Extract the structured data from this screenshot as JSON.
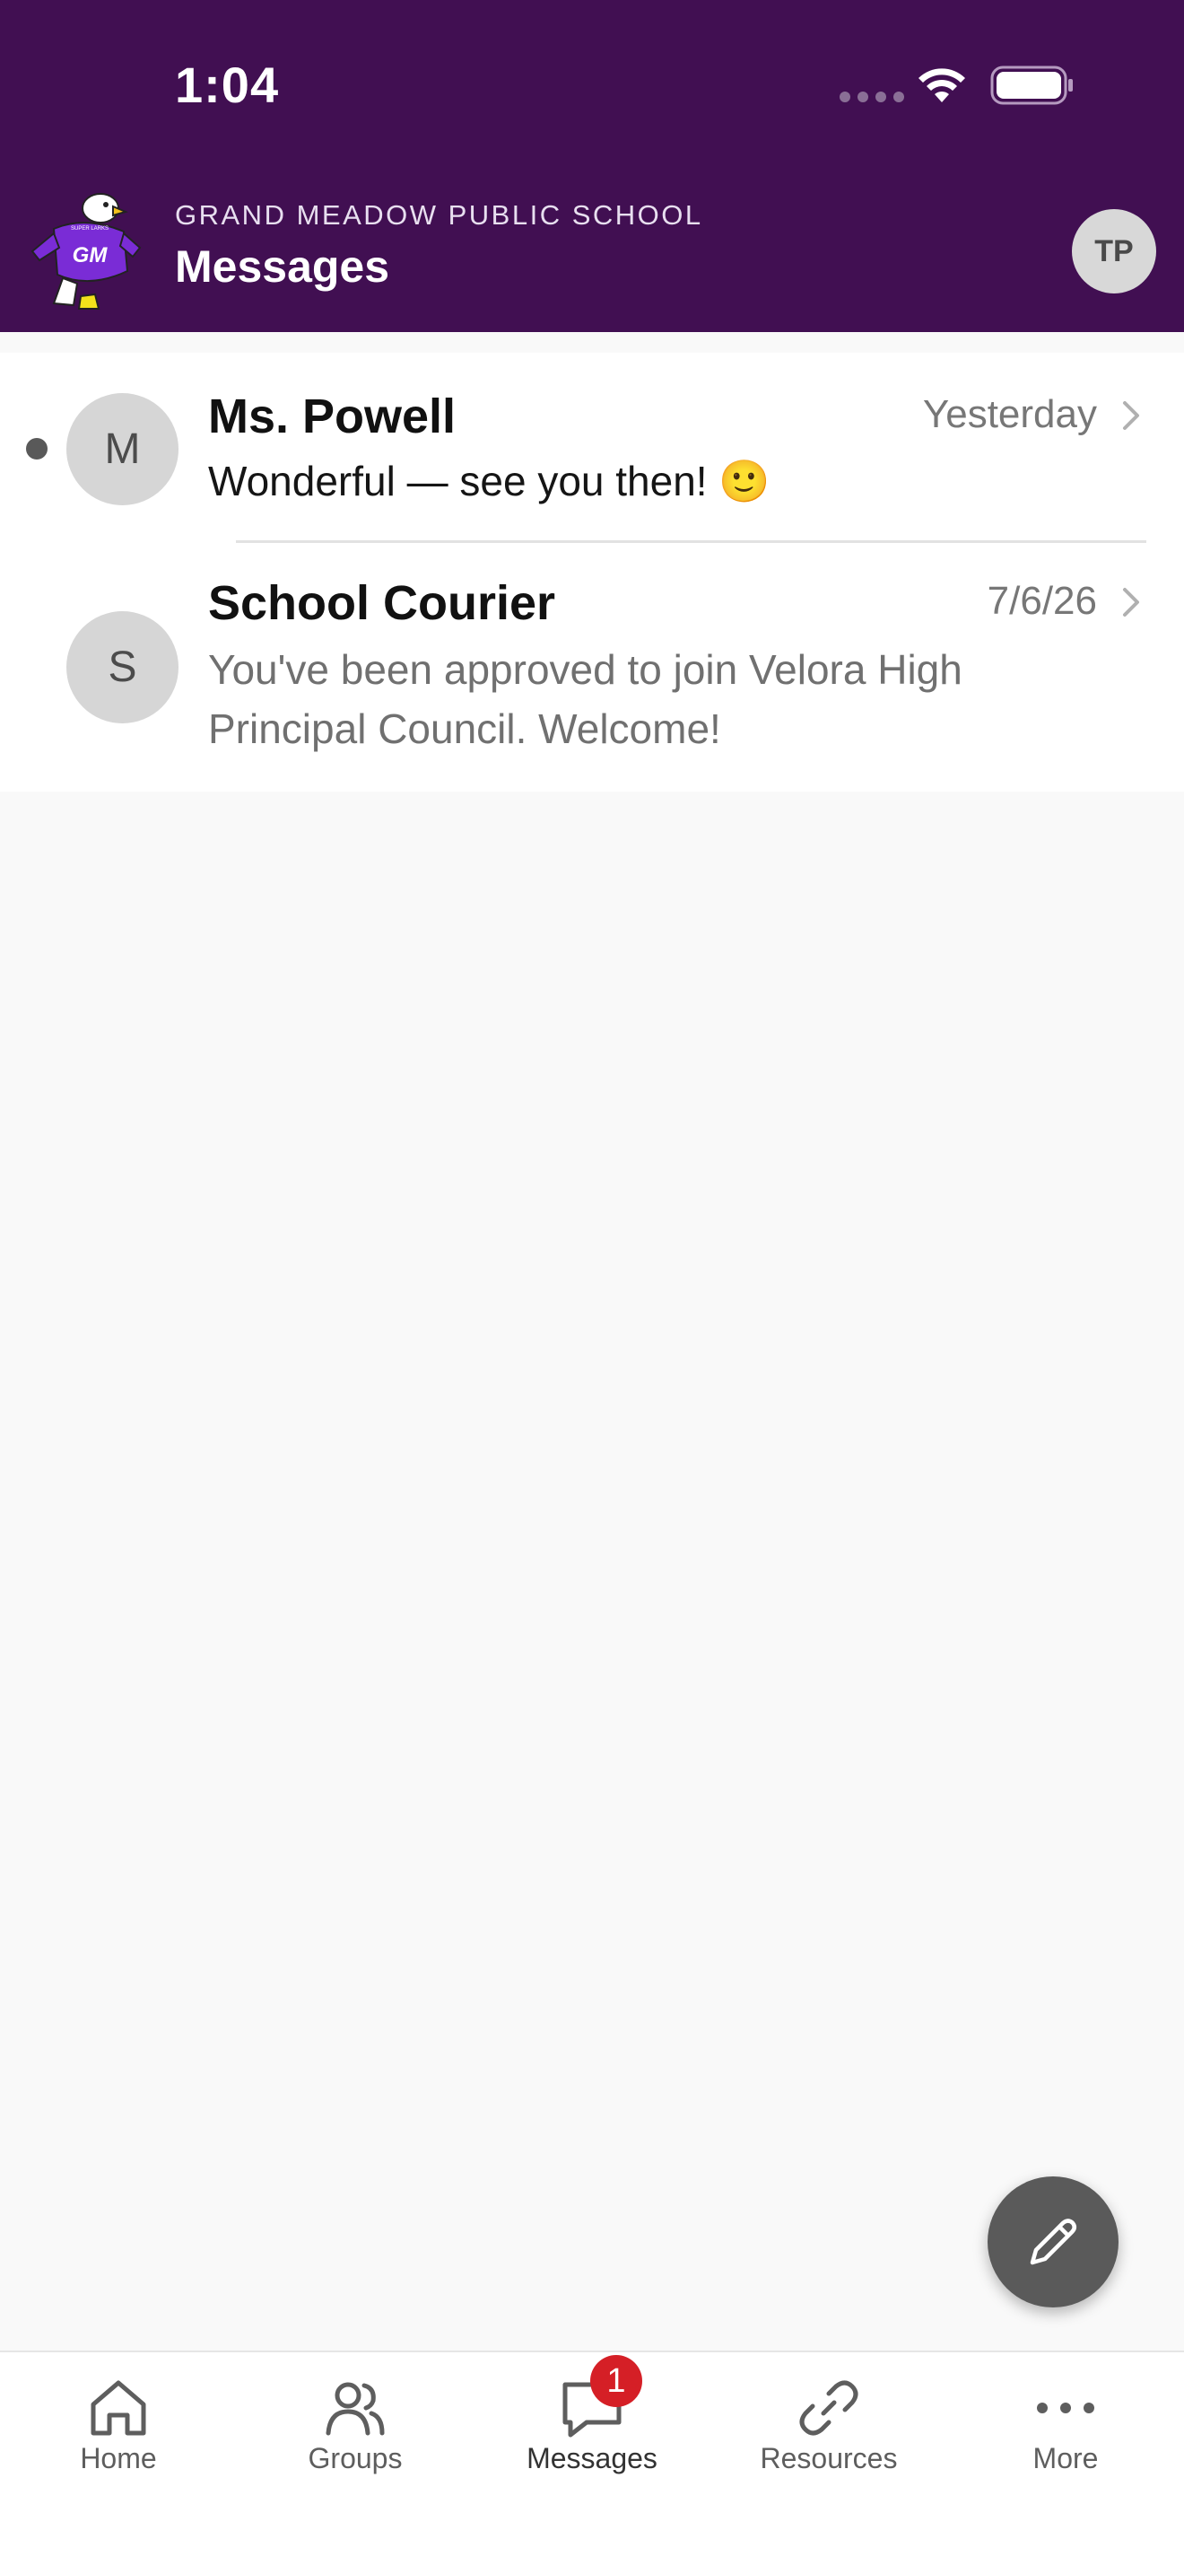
{
  "status_bar": {
    "time": "1:04"
  },
  "header": {
    "school_name": "GRAND MEADOW PUBLIC SCHOOL",
    "title": "Messages",
    "profile_initials": "TP",
    "logo_text": "GM",
    "logo_banner": "SUPER LARKS"
  },
  "messages": [
    {
      "avatar_initial": "M",
      "sender": "Ms. Powell",
      "date": "Yesterday",
      "preview": "Wonderful — see you then! 🙂",
      "unread": true
    },
    {
      "avatar_initial": "S",
      "sender": "School Courier",
      "date": "7/6/26",
      "preview": "You've been approved to join Velora High Principal Council. Welcome!",
      "unread": false
    }
  ],
  "compose_icon": "pencil-icon",
  "tabs": [
    {
      "label": "Home",
      "icon": "home-icon"
    },
    {
      "label": "Groups",
      "icon": "groups-icon"
    },
    {
      "label": "Messages",
      "icon": "message-bubble-icon",
      "badge": "1"
    },
    {
      "label": "Resources",
      "icon": "link-icon"
    },
    {
      "label": "More",
      "icon": "more-dots-icon"
    }
  ],
  "colors": {
    "header_bg": "#410f52",
    "list_bg": "#ffffff",
    "page_bg": "#f9f9f9",
    "badge": "#d51f26",
    "fab": "#5a5a5a"
  }
}
